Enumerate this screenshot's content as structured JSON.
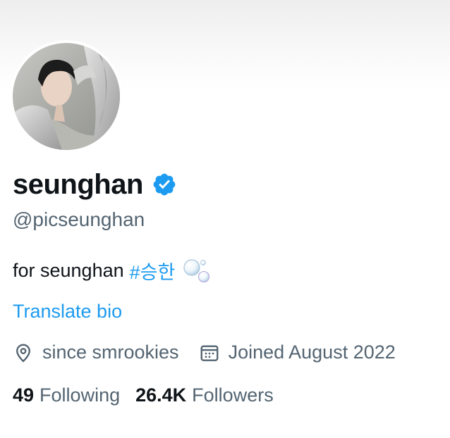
{
  "profile": {
    "display_name": "seunghan",
    "verified": true,
    "handle": "@picseunghan",
    "bio_text": "for seunghan",
    "bio_hashtag": "#승한",
    "bio_emoji": "bubbles-emoji",
    "translate_label": "Translate bio",
    "location": "since smrookies",
    "joined": "Joined August 2022",
    "following_count": "49",
    "following_label": "Following",
    "followers_count": "26.4K",
    "followers_label": "Followers"
  },
  "icons": {
    "verified": "verified-badge-icon",
    "location": "location-pin-icon",
    "calendar": "calendar-icon"
  },
  "colors": {
    "text": "#0f1419",
    "secondary": "#536471",
    "accent": "#1d9bf0"
  }
}
